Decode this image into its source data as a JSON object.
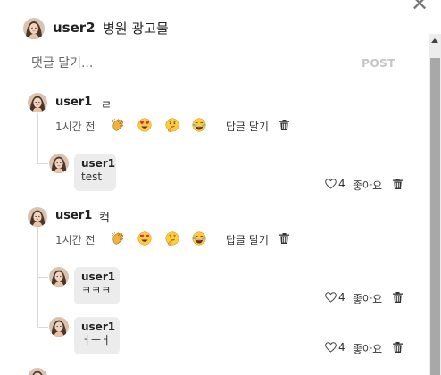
{
  "post": {
    "author": "user2",
    "caption": "병원 광고물"
  },
  "comment_input": {
    "placeholder": "댓글 달기...",
    "value": "",
    "post_label": "POST"
  },
  "comments": [
    {
      "user": "user1",
      "text": "ㄹ",
      "time": "1시간 전",
      "reply_label": "답글 달기",
      "replies": [
        {
          "user": "user1",
          "text": "test",
          "likes": "4",
          "like_label": "좋아요"
        }
      ]
    },
    {
      "user": "user1",
      "text": "컥",
      "time": "1시간 전",
      "reply_label": "답글 달기",
      "replies": [
        {
          "user": "user1",
          "text": "ㅋㅋㅋ",
          "likes": "4",
          "like_label": "좋아요"
        },
        {
          "user": "user1",
          "text": "ㅓㅡㅓ",
          "likes": "4",
          "like_label": "좋아요"
        }
      ]
    }
  ],
  "reactions": [
    "clapping-hands",
    "heart-eyes",
    "thinking-face",
    "tears-of-joy"
  ]
}
